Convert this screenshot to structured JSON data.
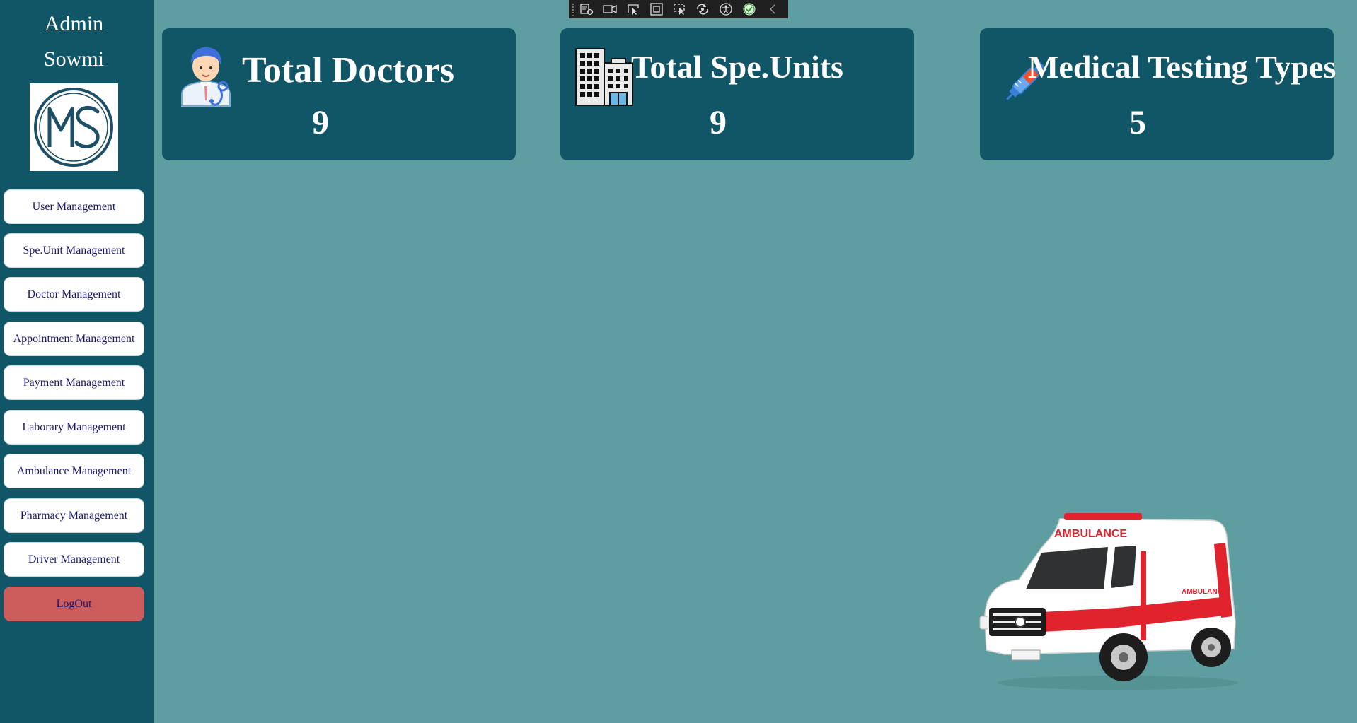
{
  "sidebar": {
    "user_line1": "Admin",
    "user_line2": "Sowmi",
    "logo_text": "MS",
    "items": [
      {
        "label": "User Management"
      },
      {
        "label": "Spe.Unit Management"
      },
      {
        "label": "Doctor Management"
      },
      {
        "label": "Appointment Management"
      },
      {
        "label": "Payment Management"
      },
      {
        "label": "Laborary Management"
      },
      {
        "label": "Ambulance Management"
      },
      {
        "label": "Pharmacy Management"
      },
      {
        "label": "Driver Management"
      }
    ],
    "logout_label": "LogOut"
  },
  "devtools": {
    "icons": [
      "live-tree-icon",
      "record-icon",
      "select-element-icon",
      "display-layout-icon",
      "track-focus-icon",
      "hot-reload-icon",
      "accessibility-icon",
      "check-icon",
      "collapse-icon"
    ]
  },
  "cards": [
    {
      "title": "Total Doctors",
      "value": "9",
      "icon": "doctor-icon"
    },
    {
      "title": "Total Spe.Units",
      "value": "9",
      "icon": "building-icon"
    },
    {
      "title": "Medical Testing Types",
      "value": "5",
      "icon": "syringe-icon"
    }
  ],
  "illustration": {
    "icon": "ambulance-icon",
    "text": "AMBULANCE"
  },
  "colors": {
    "sidebar_bg": "#115667",
    "page_bg": "#5f9ea0",
    "card_bg": "#115667",
    "nav_text": "#191970",
    "logout_bg": "#cd5c5c"
  }
}
